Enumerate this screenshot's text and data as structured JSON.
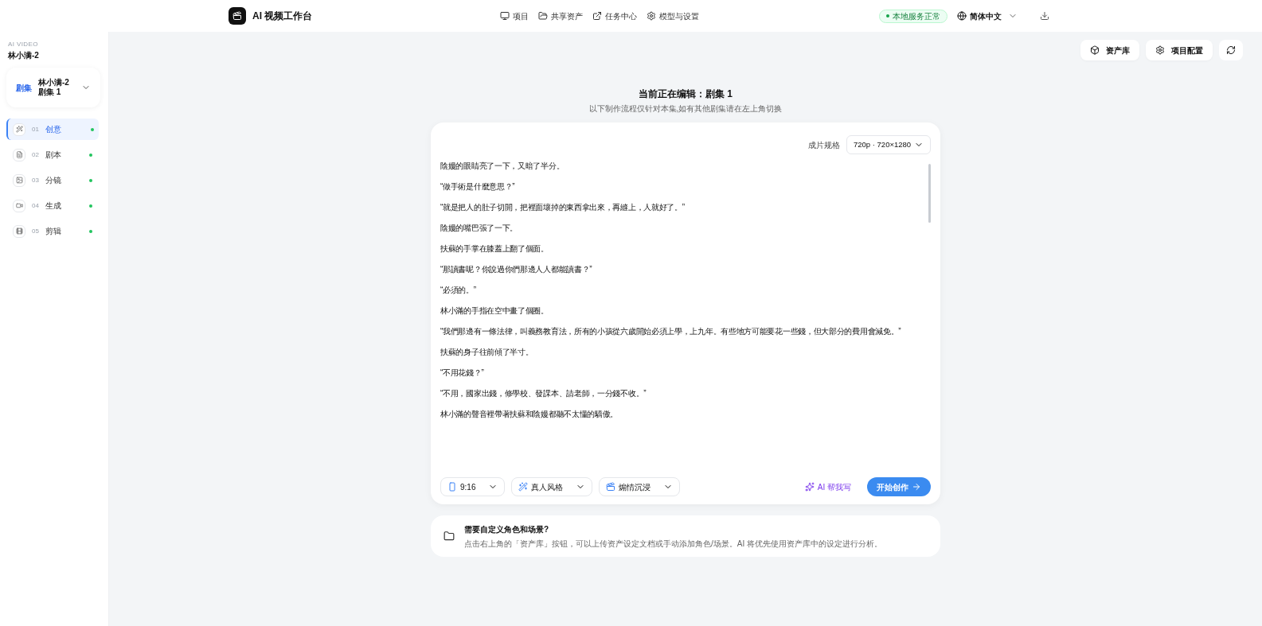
{
  "header": {
    "title": "AI 视频工作台",
    "nav": [
      "项目",
      "共享资产",
      "任务中心",
      "模型与设置"
    ],
    "status": "本地服务正常",
    "language": "简体中文"
  },
  "sidebar": {
    "eyebrow": "AI VIDEO",
    "project": "林小满-2",
    "episode_picker": {
      "badge": "剧集",
      "title": "林小满-2",
      "subtitle": "剧集 1"
    },
    "steps": [
      {
        "number": "01",
        "label": "创意",
        "selected": true
      },
      {
        "number": "02",
        "label": "剧本",
        "selected": false
      },
      {
        "number": "03",
        "label": "分镜",
        "selected": false
      },
      {
        "number": "04",
        "label": "生成",
        "selected": false
      },
      {
        "number": "05",
        "label": "剪辑",
        "selected": false
      }
    ]
  },
  "toolbar": [
    "资产库",
    "项目配置"
  ],
  "editor": {
    "heading": "当前正在编辑：剧集 1",
    "subheading": "以下制作流程仅针对本集,如有其他剧集请在左上角切换",
    "spec_label": "成片规格",
    "spec_value": "720p · 720×1280",
    "paragraphs": [
      "陰嫚的眼睛亮了一下，又暗了半分。",
      "“做手術是什麼意思？”",
      "“就是把人的肚子切開，把裡面壞掉的東西拿出來，再縫上，人就好了。”",
      "陰嫚的嘴巴張了一下。",
      "扶蘇的手掌在膝蓋上翻了個面。",
      "“那讀書呢？你說過你們那邊人人都能讀書？”",
      "“必須的。”",
      "林小滿的手指在空中畫了個圈。",
      "“我們那邊有一條法律，叫義務教育法，所有的小孩從六歲開始必須上學，上九年。有些地方可能要花一些錢，但大部分的費用會減免。”",
      "扶蘇的身子往前傾了半寸。",
      "“不用花錢？”",
      "“不用，國家出錢，修學校、發課本、請老師，一分錢不收。”",
      "林小滿的聲音裡帶著扶蘇和陰嫚都聽不太懂的驕傲。"
    ],
    "options": [
      "9:16",
      "真人风格",
      "煽情沉浸"
    ],
    "ai_write": "AI 帮我写",
    "start": "开始创作"
  },
  "tip": {
    "title": "需要自定义角色和场景?",
    "text": "点击右上角的「资产库」按钮，可以上传资产设定文档或手动添加角色/场景。AI 将优先使用资产库中的设定进行分析。"
  }
}
